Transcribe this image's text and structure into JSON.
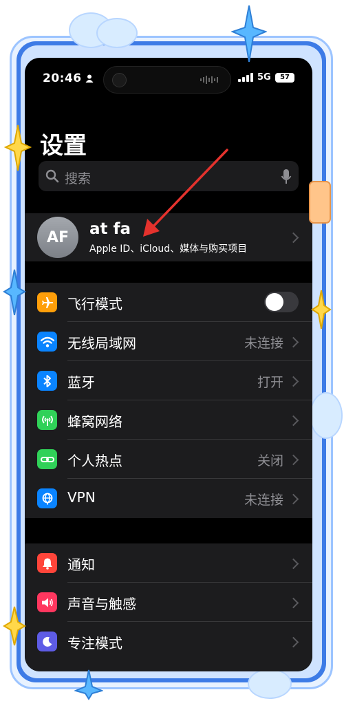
{
  "status_bar": {
    "time": "20:46",
    "network": "5G",
    "battery": "57"
  },
  "header": {
    "title": "设置"
  },
  "search": {
    "placeholder": "搜索"
  },
  "profile": {
    "initials": "AF",
    "name": "at fa",
    "subtitle": "Apple ID、iCloud、媒体与购买项目"
  },
  "connectivity": [
    {
      "label": "飞行模式",
      "value": "",
      "icon": "airplane-icon",
      "color": "#ff9f0a",
      "toggle": false
    },
    {
      "label": "无线局域网",
      "value": "未连接",
      "icon": "wifi-icon",
      "color": "#0a84ff"
    },
    {
      "label": "蓝牙",
      "value": "打开",
      "icon": "bluetooth-icon",
      "color": "#0a84ff"
    },
    {
      "label": "蜂窝网络",
      "value": "",
      "icon": "cellular-icon",
      "color": "#30d158"
    },
    {
      "label": "个人热点",
      "value": "关闭",
      "icon": "hotspot-icon",
      "color": "#30d158"
    },
    {
      "label": "VPN",
      "value": "未连接",
      "icon": "vpn-icon",
      "color": "#0a84ff"
    }
  ],
  "notifications": [
    {
      "label": "通知",
      "icon": "bell-icon",
      "color": "#ff453a"
    },
    {
      "label": "声音与触感",
      "icon": "speaker-icon",
      "color": "#ff375f"
    },
    {
      "label": "专注模式",
      "icon": "moon-icon",
      "color": "#5e5ce6"
    }
  ]
}
